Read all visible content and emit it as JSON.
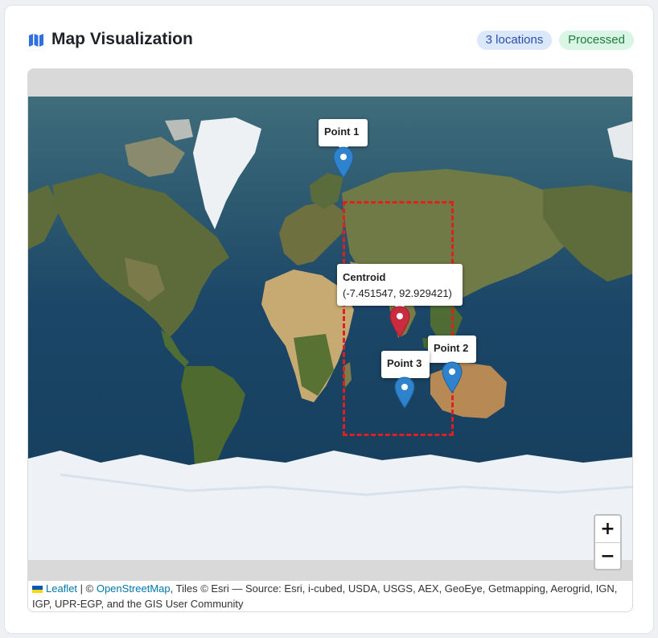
{
  "header": {
    "title": "Map Visualization",
    "title_icon": "map-icon",
    "badges": {
      "locations": "3 locations",
      "status": "Processed"
    }
  },
  "map": {
    "base_layer": "satellite imagery (Esri World Imagery)",
    "markers": [
      {
        "label": "Point 1",
        "color": "#2f82cc"
      },
      {
        "label": "Point 2",
        "color": "#2f82cc"
      },
      {
        "label": "Point 3",
        "color": "#2f82cc"
      }
    ],
    "centroid": {
      "label": "Centroid",
      "coords_text": "(-7.451547, 92.929421)",
      "color": "#cb2b3e"
    },
    "bounding_box": {
      "style": "dashed",
      "color": "#e02020"
    },
    "zoom": {
      "in_label": "+",
      "out_label": "−"
    },
    "attribution": {
      "leaflet_label": "Leaflet",
      "sep1": " | © ",
      "osm_label": "OpenStreetMap",
      "rest": ", Tiles © Esri — Source: Esri, i-cubed, USDA, USGS, AEX, GeoEye, Getmapping, Aerogrid, IGN, IGP, UPR-EGP, and the GIS User Community"
    }
  }
}
